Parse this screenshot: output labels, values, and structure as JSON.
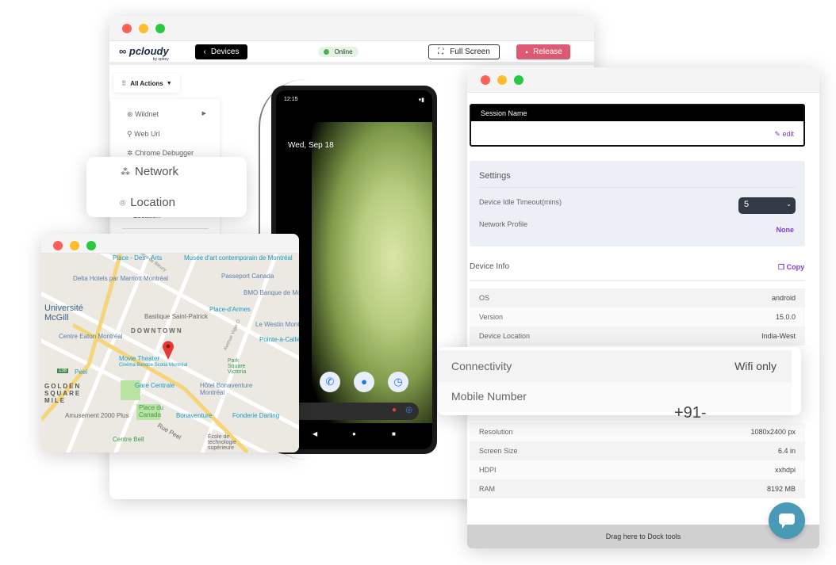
{
  "main_window": {
    "logo": "pcloudy",
    "logo_sub": "by opkey",
    "devices_button": "Devices",
    "status": "Online",
    "full_screen_button": "Full Screen",
    "release_button": "Release",
    "all_actions": "All Actions",
    "menu": [
      {
        "label": "Wildnet",
        "icon": "wildnet-icon",
        "submenu": true
      },
      {
        "label": "Web Url",
        "icon": "link-icon"
      },
      {
        "label": "Chrome Debugger",
        "icon": "bug-icon"
      },
      {
        "label": "Location",
        "icon": "location-pin-icon"
      }
    ]
  },
  "popup_menu": {
    "items": [
      {
        "label": "Network",
        "icon": "network-icon"
      },
      {
        "label": "Location",
        "icon": "location-pin-icon"
      }
    ]
  },
  "phone": {
    "time": "12:15",
    "date": "Wed, Sep 18"
  },
  "map": {
    "labels": [
      "Place - Des - Arts",
      "Musée d'art contemporain de Montréal",
      "Delta Hotels par Marriott Montréal",
      "Passeport Canada",
      "BMO Banque de Montréal",
      "Université McGill",
      "Place-d'Armes",
      "Basilique Saint-Patrick",
      "Le Westin Montréal",
      "DOWNTOWN",
      "Centre Eaton Montréal",
      "Pointe-à-Callière",
      "Movie Theater",
      "Cinéma Banque Scotia Montréal",
      "Park Square Victoria",
      "Peel",
      "GOLDEN SQUARE MILE",
      "Gare Centrale",
      "Hôtel Bonaventure Montréal",
      "Place du Canada",
      "Amusement 2000 Plus",
      "Bonaventure",
      "Fonderie Darling",
      "Rue Peel",
      "Centre Bell",
      "École de technologie supérieure",
      "Rue de Bleury",
      "Avenue Viger O",
      "138"
    ],
    "pin_color": "#e53935"
  },
  "side_panel": {
    "session_name_label": "Session Name",
    "edit_label": "edit",
    "settings_title": "Settings",
    "idle_timeout_label": "Device Idle Timeout(mins)",
    "idle_timeout_value": "5",
    "network_profile_label": "Network Profile",
    "network_profile_value": "None",
    "device_info_title": "Device Info",
    "copy_label": "Copy",
    "rows_top": [
      {
        "label": "OS",
        "value": "android"
      },
      {
        "label": "Version",
        "value": "15.0.0"
      },
      {
        "label": "Device Location",
        "value": "India-West"
      }
    ],
    "rows_bottom": [
      {
        "label": "Resolution",
        "value": "1080x2400 px"
      },
      {
        "label": "Screen Size",
        "value": "6.4 in"
      },
      {
        "label": "HDPI",
        "value": "xxhdpi"
      },
      {
        "label": "RAM",
        "value": "8192 MB"
      }
    ],
    "dock_label": "Drag here to Dock tools"
  },
  "connectivity_popup": {
    "connectivity_label": "Connectivity",
    "connectivity_value": "Wifi only",
    "mobile_label": "Mobile Number",
    "mobile_value": "+91-"
  },
  "colors": {
    "release": "#dc5b73",
    "accent_purple": "#7b3fd1",
    "online": "#4caf50",
    "chat": "#4a9ab5"
  }
}
